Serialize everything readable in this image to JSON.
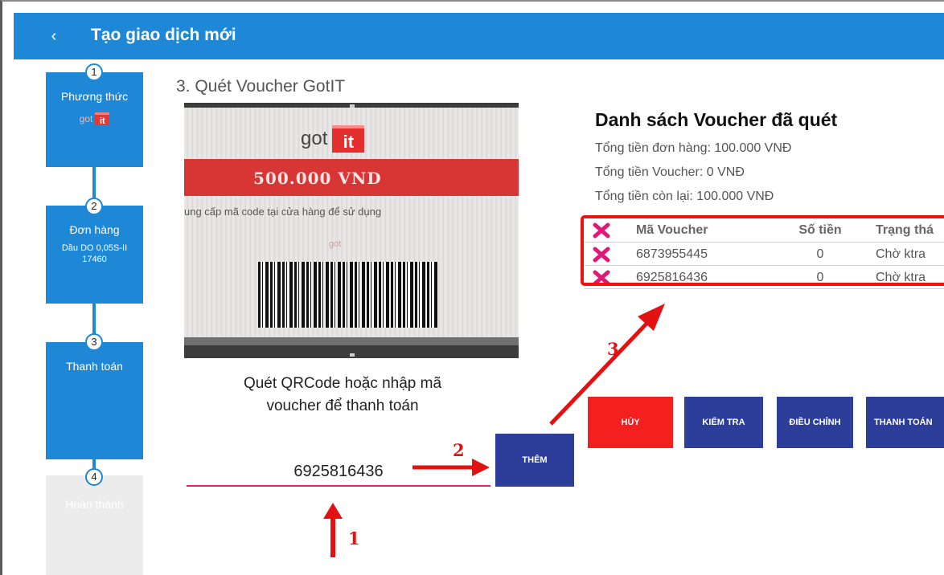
{
  "header": {
    "back_glyph": "‹",
    "title": "Tạo giao dịch mới"
  },
  "steps": [
    {
      "num": "1",
      "label": "Phương thức",
      "sub_brand": "got",
      "sub_badge": "it"
    },
    {
      "num": "2",
      "label": "Đơn hàng",
      "sub_line1": "Dầu DO 0,05S-II",
      "sub_line2": "17460"
    },
    {
      "num": "3",
      "label": "Thanh toán"
    },
    {
      "num": "4",
      "label": "Hoàn thành"
    }
  ],
  "section_title": "3. Quét Voucher GotIT",
  "camera": {
    "logo_text": "got",
    "logo_badge": "it",
    "amount": "500.000 VND",
    "hint": "ung cấp mã code tại cửa hàng để sử dụng",
    "mini_logo": "got"
  },
  "scan_hint": {
    "line1": "Quét QRCode hoặc nhập mã",
    "line2": "voucher để thanh toán"
  },
  "voucher_input": {
    "value": "6925816436"
  },
  "buttons": {
    "add": "THÊM",
    "cancel": "HỦY",
    "check": "KIỂM TRA",
    "adjust": "ĐIỀU CHỈNH",
    "pay": "THANH TOÁN"
  },
  "voucher_list": {
    "title": "Danh sách Voucher đã quét",
    "order_total": "Tổng tiền đơn hàng: 100.000  VNĐ",
    "voucher_total": "Tổng tiền Voucher: 0  VNĐ",
    "remaining": "Tổng tiền còn lại: 100.000  VNĐ",
    "columns": [
      "Mã Voucher",
      "Số tiền",
      "Trạng thá"
    ],
    "rows": [
      {
        "code": "6873955445",
        "amount": "0",
        "status": "Chờ ktra"
      },
      {
        "code": "6925816436",
        "amount": "0",
        "status": "Chờ ktra"
      }
    ]
  },
  "annotations": {
    "one": "1",
    "two": "2",
    "three": "3"
  },
  "colors": {
    "primary": "#1e88d6",
    "button_dark": "#2c3e99",
    "danger": "#f41f1f",
    "annotation": "#e31212",
    "input_underline": "#e91e63"
  }
}
